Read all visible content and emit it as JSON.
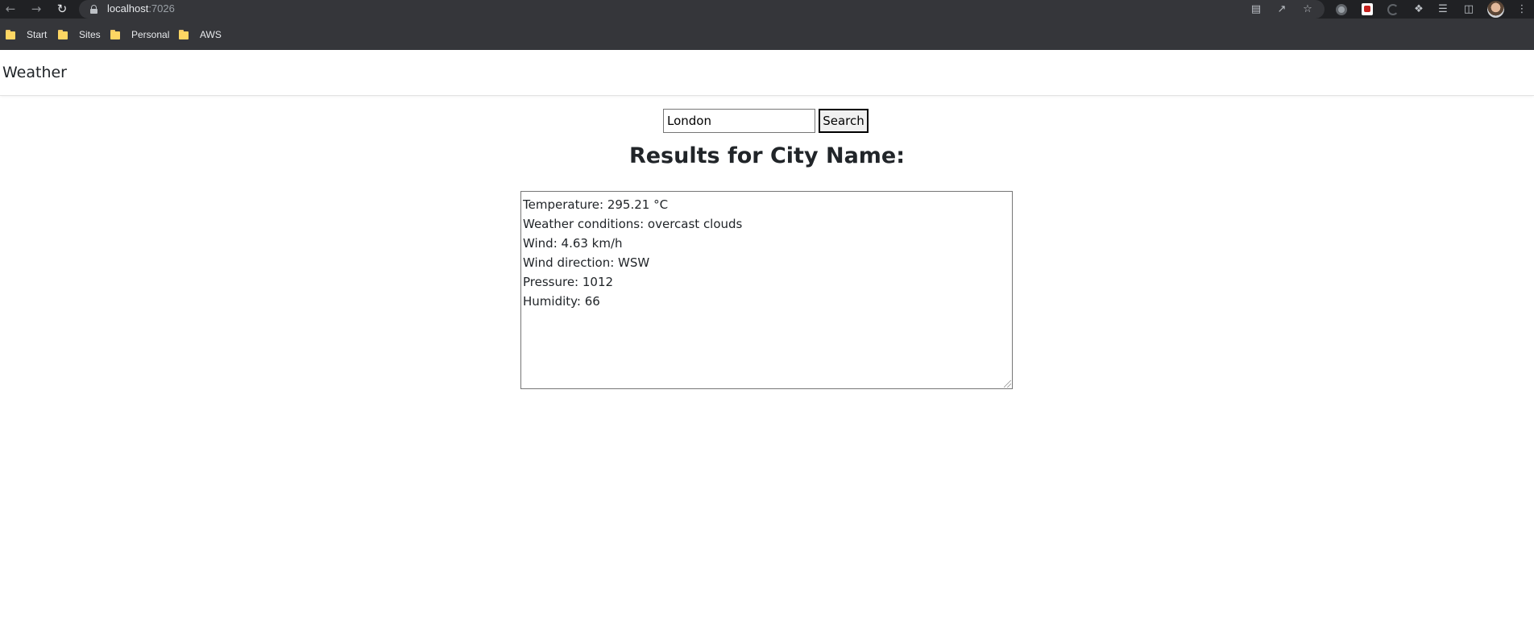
{
  "browser": {
    "url_host": "localhost",
    "url_port": ":7026",
    "bookmarks": [
      {
        "label": "Start"
      },
      {
        "label": "Sites"
      },
      {
        "label": "Personal"
      },
      {
        "label": "AWS"
      }
    ]
  },
  "navbar": {
    "brand": "Weather"
  },
  "search": {
    "value": "London",
    "button_label": "Search"
  },
  "results": {
    "title": "Results for City Name:",
    "lines": [
      "Temperature: 295.21 °C",
      "Weather conditions: overcast clouds",
      "Wind: 4.63 km/h",
      "Wind direction: WSW",
      "Pressure: 1012",
      "Humidity: 66"
    ]
  }
}
